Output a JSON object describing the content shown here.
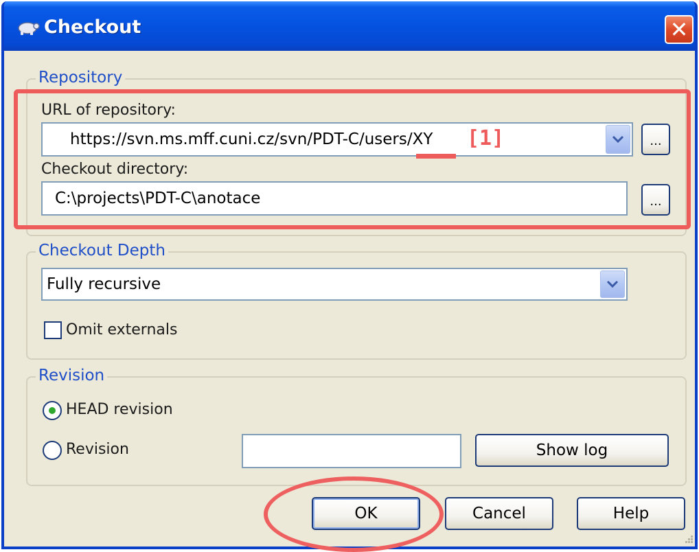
{
  "window": {
    "title": "Checkout",
    "close_glyph": "✕"
  },
  "repository": {
    "legend": "Repository",
    "url_label": "URL of repository:",
    "url_value": "https://svn.ms.mff.cuni.cz/svn/PDT-C/users/XY",
    "browse_label": "...",
    "dir_label": "Checkout directory:",
    "dir_value": "C:\\projects\\PDT-C\\anotace",
    "dir_browse_label": "..."
  },
  "annotation": {
    "marker": "[1]",
    "color": "#ee5b5b"
  },
  "depth": {
    "legend": "Checkout Depth",
    "selected": "Fully recursive",
    "omit_externals_label": "Omit externals",
    "omit_externals_checked": false
  },
  "revision": {
    "legend": "Revision",
    "head_label": "HEAD revision",
    "revision_label": "Revision",
    "revision_value": "",
    "show_log_label": "Show log",
    "selected": "HEAD revision"
  },
  "buttons": {
    "ok": "OK",
    "cancel": "Cancel",
    "help": "Help"
  },
  "icons": {
    "title": "tortoise-icon",
    "combo": "chevron-down-icon",
    "close": "close-icon"
  }
}
